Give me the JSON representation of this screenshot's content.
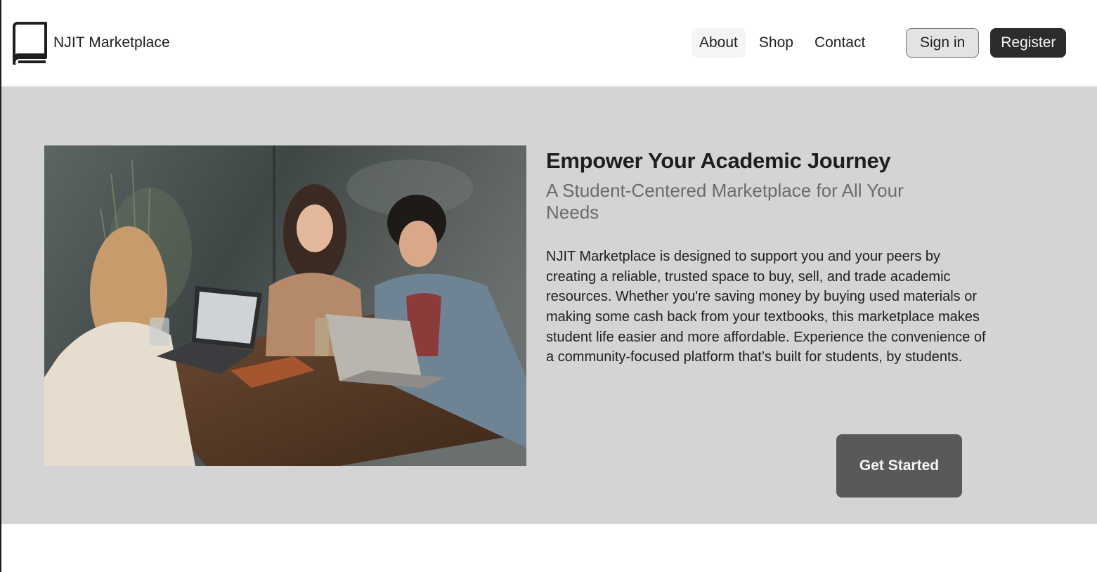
{
  "header": {
    "brand_name": "NJIT Marketplace",
    "brand_icon": "book-icon",
    "nav": [
      {
        "label": "About",
        "active": true
      },
      {
        "label": "Shop",
        "active": false
      },
      {
        "label": "Contact",
        "active": false
      }
    ],
    "sign_in_label": "Sign in",
    "register_label": "Register"
  },
  "hero": {
    "title": "Empower Your Academic Journey",
    "subtitle": "A Student-Centered Marketplace for All Your Needs",
    "body": "NJIT Marketplace is designed to support you and your peers by creating a reliable, trusted space to buy, sell, and trade academic resources. Whether you're saving money by buying used materials or making some cash back from your textbooks, this marketplace makes student life easier and more affordable. Experience the convenience of a community-focused platform that’s built for students, by students.",
    "cta_label": "Get Started"
  },
  "colors": {
    "hero_background": "#d4d4d4",
    "primary_button": "#2c2c2c",
    "cta_button": "#595959",
    "subtitle_text": "#6b6b6b"
  }
}
